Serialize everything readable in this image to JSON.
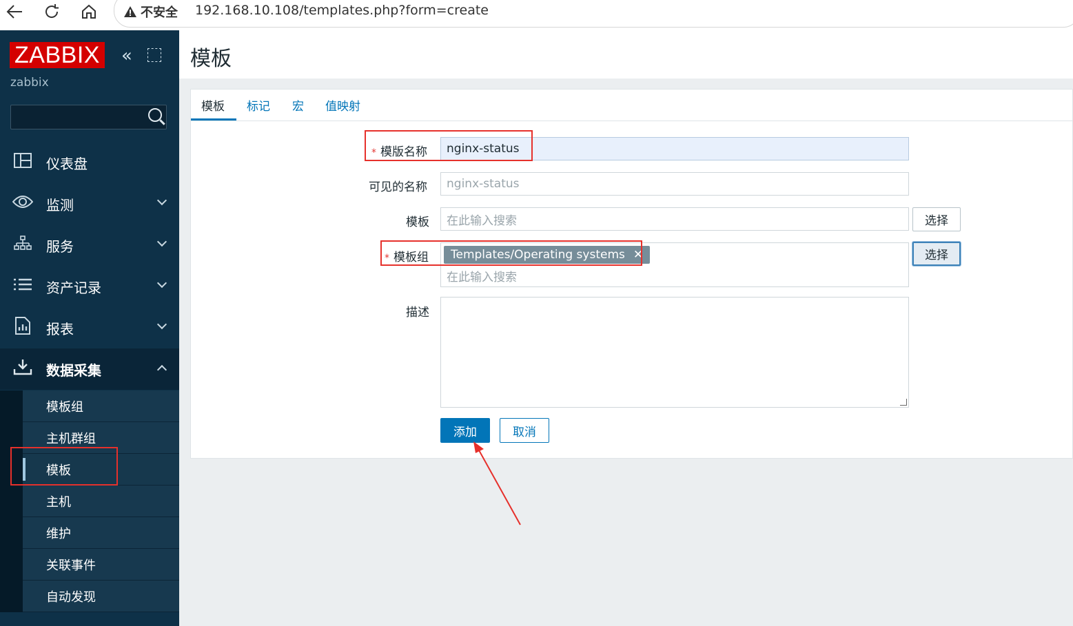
{
  "browser": {
    "insecure_label": "不安全",
    "url": "192.168.10.108/templates.php?form=create"
  },
  "sidebar": {
    "logo": "ZABBIX",
    "server_name": "zabbix",
    "menu": [
      {
        "label": "仪表盘",
        "icon": "dashboard-icon"
      },
      {
        "label": "监测",
        "icon": "eye-icon"
      },
      {
        "label": "服务",
        "icon": "services-icon"
      },
      {
        "label": "资产记录",
        "icon": "list-icon"
      },
      {
        "label": "报表",
        "icon": "report-icon"
      },
      {
        "label": "数据采集",
        "icon": "download-icon"
      }
    ],
    "submenu": [
      "模板组",
      "主机群组",
      "模板",
      "主机",
      "维护",
      "关联事件",
      "自动发现"
    ]
  },
  "page": {
    "title": "模板"
  },
  "tabs": [
    "模板",
    "标记",
    "宏",
    "值映射"
  ],
  "form": {
    "template_name_label": "模版名称",
    "template_name_value": "nginx-status",
    "visible_name_label": "可见的名称",
    "visible_name_placeholder": "nginx-status",
    "templates_label": "模板",
    "templates_placeholder": "在此输入搜索",
    "select_label": "选择",
    "groups_label": "模板组",
    "groups_chip": "Templates/Operating systems",
    "groups_chip_remove": "✕",
    "groups_placeholder": "在此输入搜索",
    "description_label": "描述",
    "add_label": "添加",
    "cancel_label": "取消"
  }
}
